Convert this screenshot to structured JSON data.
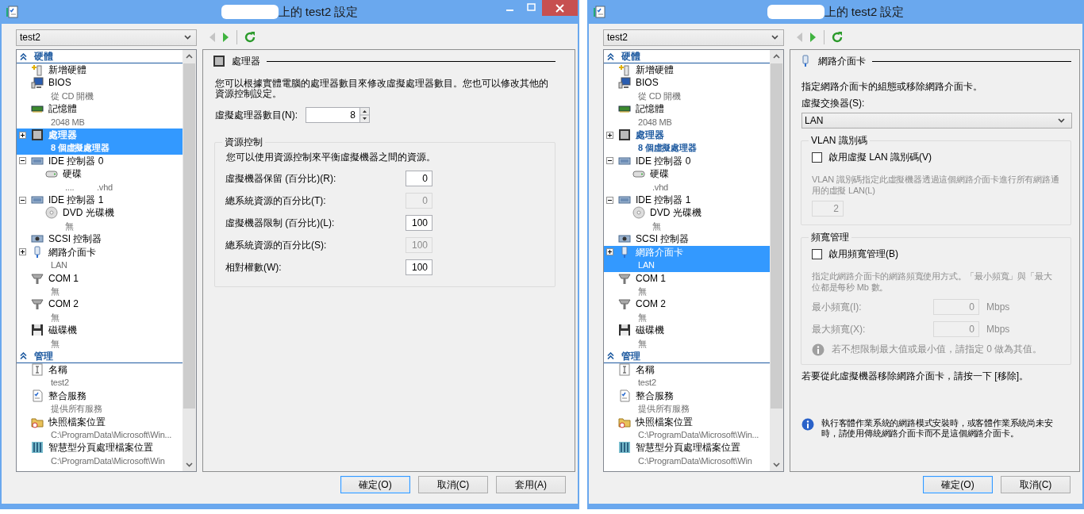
{
  "windows": [
    {
      "title": "上的 test2 設定",
      "caption_buttons": true,
      "vm_select": "test2",
      "nav": {
        "back_enabled": false,
        "forward_enabled": true
      },
      "sections": [
        {
          "label": "硬體",
          "items": [
            {
              "kind": "add-hardware",
              "name": "新增硬體",
              "selected": false,
              "modified": false
            },
            {
              "kind": "bios",
              "name": "BIOS",
              "detail": "從 CD 開機",
              "selected": false,
              "modified": false
            },
            {
              "kind": "memory",
              "name": "記憶體",
              "detail": "2048 MB",
              "selected": false,
              "modified": false
            },
            {
              "kind": "processor",
              "name": "處理器",
              "detail": "8 個虛擬處理器",
              "expanded": false,
              "selected": true,
              "modified": true
            },
            {
              "kind": "ide",
              "name": "IDE 控制器 0",
              "expanded": true,
              "selected": false,
              "modified": false,
              "children": [
                {
                  "kind": "disk",
                  "name": "硬碟",
                  "detail": "....          .vhd",
                  "selected": false,
                  "modified": false
                }
              ]
            },
            {
              "kind": "ide",
              "name": "IDE 控制器 1",
              "expanded": true,
              "selected": false,
              "modified": false,
              "children": [
                {
                  "kind": "dvd",
                  "name": "DVD 光碟機",
                  "detail": "無",
                  "selected": false,
                  "modified": false
                }
              ]
            },
            {
              "kind": "scsi",
              "name": "SCSI 控制器",
              "selected": false,
              "modified": false
            },
            {
              "kind": "nic",
              "name": "網路介面卡",
              "detail": "LAN",
              "expanded": false,
              "selected": false,
              "modified": false
            },
            {
              "kind": "com",
              "name": "COM 1",
              "detail": "無",
              "selected": false,
              "modified": false
            },
            {
              "kind": "com",
              "name": "COM 2",
              "detail": "無",
              "selected": false,
              "modified": false
            },
            {
              "kind": "floppy",
              "name": "磁碟機",
              "detail": "無",
              "selected": false,
              "modified": false
            }
          ]
        },
        {
          "label": "管理",
          "items": [
            {
              "kind": "name",
              "name": "名稱",
              "detail": "test2",
              "selected": false,
              "modified": false
            },
            {
              "kind": "integration",
              "name": "整合服務",
              "detail": "提供所有服務",
              "selected": false,
              "modified": false
            },
            {
              "kind": "snapshot",
              "name": "快照檔案位置",
              "detail": "C:\\ProgramData\\Microsoft\\Win...",
              "selected": false,
              "modified": false
            },
            {
              "kind": "paging",
              "name": "智慧型分頁處理檔案位置",
              "detail": "C:\\ProgramData\\Microsoft\\Win",
              "selected": false,
              "modified": false
            }
          ]
        }
      ],
      "page": {
        "kind": "processor",
        "heading": "處理器",
        "description": "您可以根據實體電腦的處理器數目來修改虛擬處理器數目。您也可以修改其他的資源控制設定。",
        "count": {
          "label": "虛擬處理器數目(N):",
          "value": "8"
        },
        "group": {
          "title": "資源控制",
          "description": "您可以使用資源控制來平衡虛擬機器之間的資源。",
          "rows": [
            {
              "label": "虛擬機器保留 (百分比)(R):",
              "value": "0",
              "disabled": false
            },
            {
              "label": "總系統資源的百分比(T):",
              "value": "0",
              "disabled": true
            },
            {
              "label": "虛擬機器限制 (百分比)(L):",
              "value": "100",
              "disabled": false
            },
            {
              "label": "總系統資源的百分比(S):",
              "value": "100",
              "disabled": true
            },
            {
              "label": "相對權數(W):",
              "value": "100",
              "disabled": false
            }
          ]
        }
      },
      "buttons": [
        {
          "label": "確定(O)",
          "default": true
        },
        {
          "label": "取消(C)",
          "default": false
        },
        {
          "label": "套用(A)",
          "default": false
        }
      ]
    },
    {
      "title": "上的 test2 設定",
      "caption_buttons": false,
      "vm_select": "test2",
      "nav": {
        "back_enabled": false,
        "forward_enabled": true
      },
      "sections": [
        {
          "label": "硬體",
          "items": [
            {
              "kind": "add-hardware",
              "name": "新增硬體",
              "selected": false,
              "modified": false
            },
            {
              "kind": "bios",
              "name": "BIOS",
              "detail": "從 CD 開機",
              "selected": false,
              "modified": false
            },
            {
              "kind": "memory",
              "name": "記憶體",
              "detail": "2048 MB",
              "selected": false,
              "modified": false
            },
            {
              "kind": "processor",
              "name": "處理器",
              "detail": "8 個虛擬處理器",
              "expanded": false,
              "selected": false,
              "modified": true
            },
            {
              "kind": "ide",
              "name": "IDE 控制器 0",
              "expanded": true,
              "selected": false,
              "modified": false,
              "children": [
                {
                  "kind": "disk",
                  "name": "硬碟",
                  "detail": ".vhd",
                  "selected": false,
                  "modified": false
                }
              ]
            },
            {
              "kind": "ide",
              "name": "IDE 控制器 1",
              "expanded": true,
              "selected": false,
              "modified": false,
              "children": [
                {
                  "kind": "dvd",
                  "name": "DVD 光碟機",
                  "detail": "無",
                  "selected": false,
                  "modified": false
                }
              ]
            },
            {
              "kind": "scsi",
              "name": "SCSI 控制器",
              "selected": false,
              "modified": false
            },
            {
              "kind": "nic",
              "name": "網路介面卡",
              "detail": "LAN",
              "expanded": false,
              "selected": true,
              "modified": false
            },
            {
              "kind": "com",
              "name": "COM 1",
              "detail": "無",
              "selected": false,
              "modified": false
            },
            {
              "kind": "com",
              "name": "COM 2",
              "detail": "無",
              "selected": false,
              "modified": false
            },
            {
              "kind": "floppy",
              "name": "磁碟機",
              "detail": "無",
              "selected": false,
              "modified": false
            }
          ]
        },
        {
          "label": "管理",
          "items": [
            {
              "kind": "name",
              "name": "名稱",
              "detail": "test2",
              "selected": false,
              "modified": false
            },
            {
              "kind": "integration",
              "name": "整合服務",
              "detail": "提供所有服務",
              "selected": false,
              "modified": false
            },
            {
              "kind": "snapshot",
              "name": "快照檔案位置",
              "detail": "C:\\ProgramData\\Microsoft\\Win...",
              "selected": false,
              "modified": false
            },
            {
              "kind": "paging",
              "name": "智慧型分頁處理檔案位置",
              "detail": "C:\\ProgramData\\Microsoft\\Win",
              "selected": false,
              "modified": false
            }
          ]
        }
      ],
      "page": {
        "kind": "network",
        "heading": "網路介面卡",
        "description": "指定網路介面卡的組態或移除網路介面卡。",
        "switch": {
          "label": "虛擬交換器(S):",
          "value": "LAN"
        },
        "vlan": {
          "title": "VLAN 識別碼",
          "checkbox": {
            "label": "啟用虛擬 LAN 識別碼(V)",
            "checked": false
          },
          "lines": [
            "VLAN 識別碼指定此虛擬機器透過這個網路介面卡進行所有網路通",
            "用的虛擬 LAN(L)"
          ],
          "value": "2"
        },
        "bandwidth": {
          "title": "頻寬管理",
          "checkbox": {
            "label": "啟用頻寬管理(B)",
            "checked": false
          },
          "lines": [
            "指定此網路介面卡的網路頻寬使用方式。「最小頻寬」與「最大",
            "位都是每秒 Mb 數。"
          ],
          "rows": [
            {
              "label": "最小頻寬(I):",
              "value": "0",
              "unit": "Mbps"
            },
            {
              "label": "最大頻寬(X):",
              "value": "0",
              "unit": "Mbps"
            }
          ],
          "note": "若不想限制最大值或最小值，請指定 0 做為其值。"
        },
        "remove_hint": "若要從此虛擬機器移除網路介面卡，請按一下 [移除]。",
        "info_lines": [
          "執行客體作業系統的網路模式安裝時，或客體作業系統尚未安",
          "時，請使用傳統網路介面卡而不是這個網路介面卡。"
        ]
      },
      "buttons": [
        {
          "label": "確定(O)",
          "default": true
        },
        {
          "label": "取消(C)",
          "default": false
        }
      ]
    }
  ]
}
